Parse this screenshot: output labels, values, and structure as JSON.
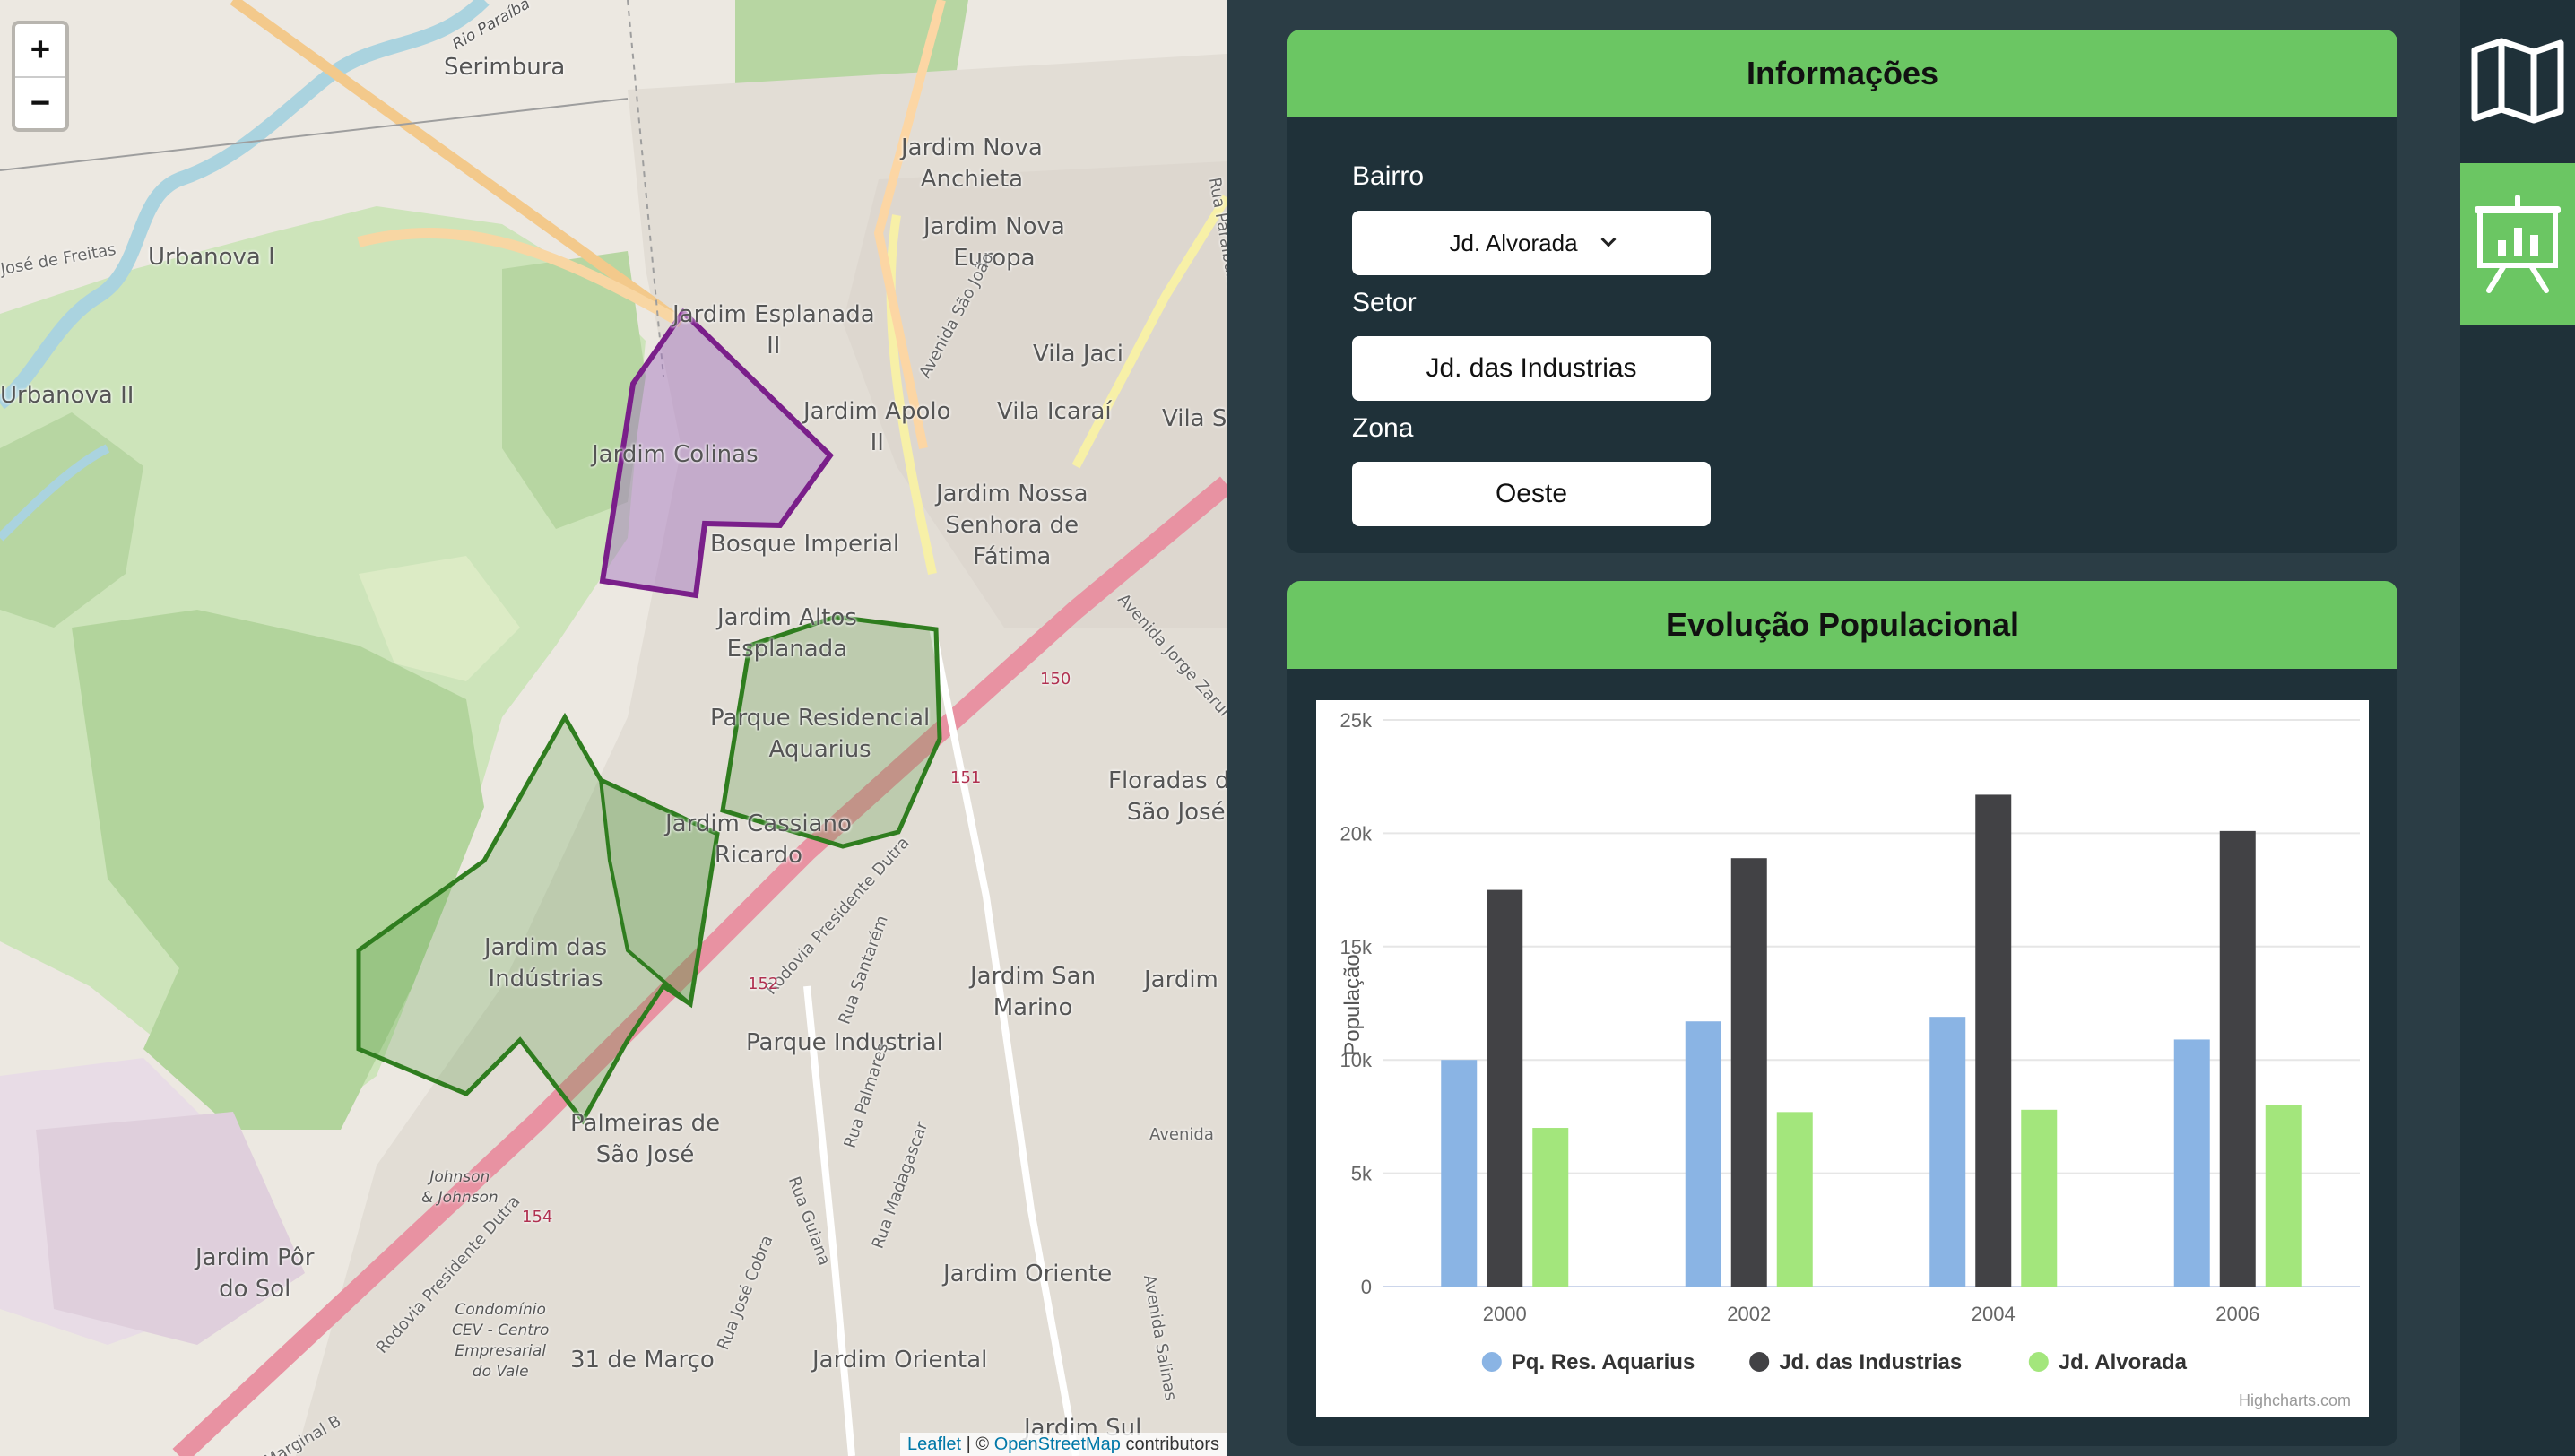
{
  "map": {
    "zoom_in": "+",
    "zoom_out": "−",
    "attribution": {
      "leaflet": "Leaflet",
      "sep": "| ©",
      "osm": "OpenStreetMap",
      "suffix": "contributors"
    },
    "places": {
      "serimbura": "Serimbura",
      "rio": "Rio Paraíba",
      "jose_freitas": "José de Freitas",
      "urbanova1": "Urbanova I",
      "urbanova2": "Urbanova II",
      "nova_anchieta": "Jardim Nova\nAnchieta",
      "nova_europa": "Jardim Nova\nEuropa",
      "esplanada": "Jardim Esplanada\nII",
      "colinas": "Jardim Colinas",
      "vila_jaci": "Vila Jaci",
      "apolo": "Jardim Apolo\nII",
      "vila_icarai": "Vila Icaraí",
      "vila_s": "Vila S",
      "nossa_senhora": "Jardim Nossa\nSenhora de\nFátima",
      "bosque": "Bosque Imperial",
      "altos": "Jardim Altos\nEsplanada",
      "aquarius": "Parque Residencial\nAquarius",
      "cassiano": "Jardim Cassiano\nRicardo",
      "floradas": "Floradas de\nSão José",
      "industrias": "Jardim das\nIndústrias",
      "san_marino": "Jardim San\nMarino",
      "jardim_right": "Jardim",
      "parque_industrial": "Parque Industrial",
      "palmeiras": "Palmeiras de\nSão José",
      "johnson": "Johnson\n& Johnson",
      "por_do_sol": "Jardim Pôr\ndo Sol",
      "condominio": "Condomínio\nCEV - Centro\nEmpresarial\ndo Vale",
      "31_marco": "31 de Março",
      "oriente": "Jardim Oriente",
      "oriental": "Jardim Oriental",
      "sul": "Jardim Sul",
      "av_sao_joao": "Avenida São João",
      "av_jorge": "Avenida Jorge Zarur",
      "rodovia": "Rodovia Presidente Dutra",
      "rodovia2": "Rodovia Presidente Dutra",
      "rua_santarem": "Rua Santarém",
      "rua_palmares": "Rua Palmares",
      "rua_madagascar": "Rua Madagascar",
      "rua_guiana": "Rua Guiana",
      "rua_jose_cobra": "Rua José Cobra",
      "av_salinas": "Avenida Salinas",
      "av_right": "Avenida",
      "rua_paraibuna": "Rua Paraibuna",
      "marginal": "Marginal B",
      "r150": "150",
      "r151": "151",
      "r152": "152",
      "r154": "154"
    },
    "colors": {
      "selected_polygon": "#7a1f8a",
      "neighbor_polygon": "#2f7d1f"
    }
  },
  "info": {
    "title": "Informações",
    "bairro_label": "Bairro",
    "bairro_value": "Jd. Alvorada",
    "setor_label": "Setor",
    "setor_value": "Jd. das Industrias",
    "zona_label": "Zona",
    "zona_value": "Oeste"
  },
  "chart_card": {
    "title": "Evolução Populacional",
    "credits": "Highcharts.com"
  },
  "chart_data": {
    "type": "bar",
    "categories": [
      "2000",
      "2002",
      "2004",
      "2006"
    ],
    "series": [
      {
        "name": "Pq. Res. Aquarius",
        "color": "#8ab4e4",
        "values": [
          10000,
          11700,
          11900,
          10900
        ]
      },
      {
        "name": "Jd. das Industrias",
        "color": "#424245",
        "values": [
          17500,
          18900,
          21700,
          20100
        ]
      },
      {
        "name": "Jd. Alvorada",
        "color": "#a3e67c",
        "values": [
          7000,
          7700,
          7800,
          8000
        ]
      }
    ],
    "ylabel": "População",
    "ylim": [
      0,
      25000
    ],
    "yticks": [
      0,
      5000,
      10000,
      15000,
      20000,
      25000
    ],
    "ytick_labels": [
      "0",
      "5k",
      "10k",
      "15k",
      "20k",
      "25k"
    ],
    "grid": true,
    "legend": "bottom"
  },
  "sidebar": {
    "map_icon": "map-icon",
    "dashboard_icon": "presentation-chart-icon",
    "accent": "#6bc663"
  }
}
